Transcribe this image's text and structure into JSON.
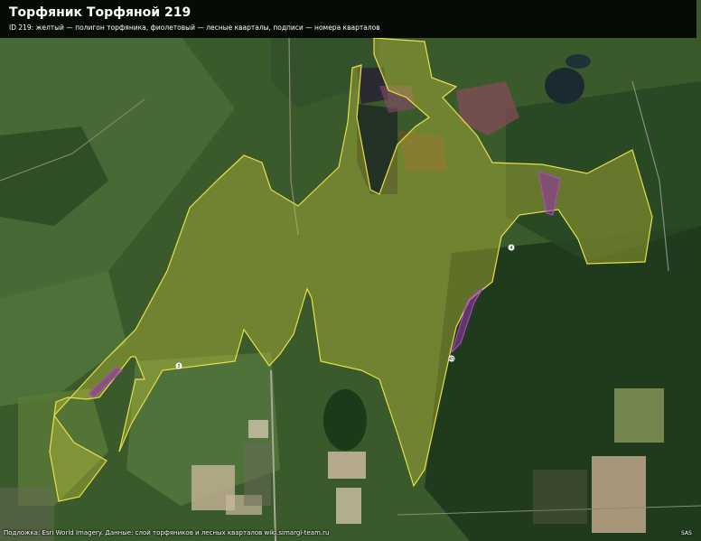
{
  "header": {
    "title": "Торфяник Торфяной 219",
    "subtitle": "ID 219: желтый — полигон торфяника, фиолетовый — лесные кварталы, подписи — номера кварталов"
  },
  "footer": {
    "attribution": "Подложка: Esri World Imagery. Данные: слой торфяников и лесных кварталов wiki.simargl-team.ru",
    "corner_mark": "SAS"
  },
  "quarter_labels": [
    "4",
    "3",
    "45"
  ],
  "colors": {
    "peat_outline": "#e8e04a",
    "peat_fill": "#c8c83a",
    "quarter_outline": "#b04ad0",
    "quarter_fill": "#9a2fa8",
    "header_bg": "#000000"
  }
}
